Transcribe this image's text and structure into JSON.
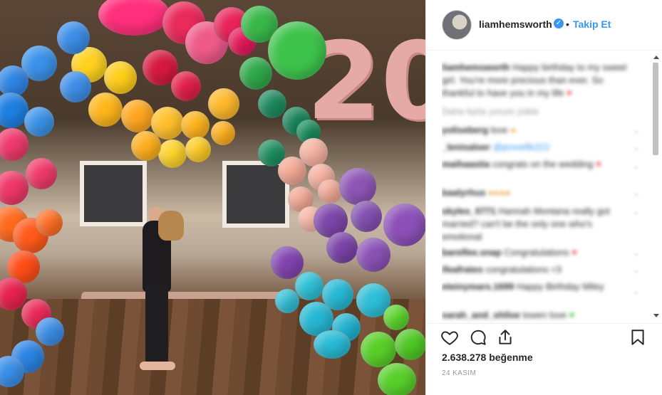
{
  "post": {
    "username": "liamhemsworth",
    "verified_glyph": "✓",
    "separator": "•",
    "follow_label": "Takip Et"
  },
  "comments": [
    {
      "user": "liamhemsworth",
      "text": "Happy birthday to my sweet girl. You're more precious than ever. So thankful to have you in my life",
      "emoji": "♥"
    },
    {
      "user": "",
      "text": "Daha fazla yorum yükle"
    },
    {
      "user": "yoliseberg",
      "text": "love",
      "emoji": "●"
    },
    {
      "user": "_lenisaloer",
      "text": "@jennefik222"
    },
    {
      "user": "maihaastia",
      "text": "congrats on the wedding",
      "emoji": "♥"
    },
    {
      "user": "baalyrhus",
      "text": "●●●●"
    },
    {
      "user": "skyles_0771",
      "text": "Hannah Montana really got married? can't be the only one who's emotional"
    },
    {
      "user": "barelfee.snap",
      "text": "Congratulations",
      "emoji": "♥"
    },
    {
      "user": "ifeafrates",
      "text": "congratulations <3"
    },
    {
      "user": "eteinymars.1699",
      "text": "Happy Birthday Miley"
    },
    {
      "user": "sarah_and_shiloe",
      "text": "lowen love",
      "emoji": "♥"
    }
  ],
  "likes": {
    "count": "2.638.278",
    "suffix": "beğenme"
  },
  "date": "24 KASIM",
  "photo": {
    "digits": "20"
  },
  "colors": {
    "accent": "#3897f0",
    "heart": "#ed4956"
  },
  "icons": [
    "verified-icon",
    "heart-icon",
    "comment-icon",
    "share-icon",
    "bookmark-icon",
    "chevron-down-icon"
  ]
}
